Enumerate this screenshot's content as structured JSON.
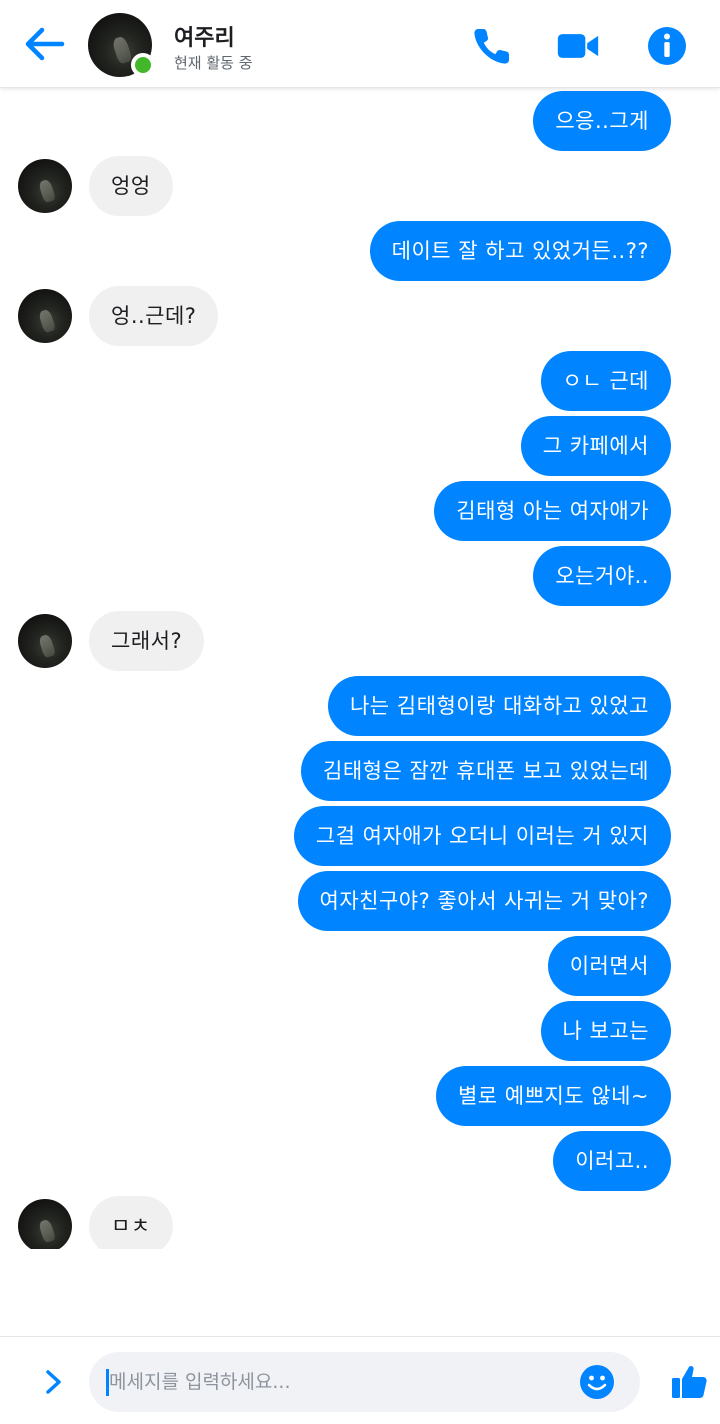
{
  "header": {
    "contact_name": "여주리",
    "status": "현재 활동 중",
    "icons": [
      "back-arrow-icon",
      "phone-icon",
      "video-camera-icon",
      "info-icon"
    ],
    "accent_color": "#0084ff",
    "online_color": "#42b72a"
  },
  "messages": [
    {
      "dir": "out",
      "text": "으응..그게"
    },
    {
      "dir": "in",
      "text": "엉엉"
    },
    {
      "dir": "out",
      "text": "데이트 잘 하고 있었거든..??"
    },
    {
      "dir": "in",
      "text": "엉..근데?"
    },
    {
      "dir": "out",
      "text": "ㅇㄴ 근데"
    },
    {
      "dir": "out",
      "text": "그 카페에서"
    },
    {
      "dir": "out",
      "text": "김태형 아는 여자애가"
    },
    {
      "dir": "out",
      "text": "오는거야.."
    },
    {
      "dir": "in",
      "text": "그래서?"
    },
    {
      "dir": "out",
      "text": "나는 김태형이랑 대화하고 있었고"
    },
    {
      "dir": "out",
      "text": "김태형은 잠깐 휴대폰 보고 있었는데"
    },
    {
      "dir": "out",
      "text": "그걸 여자애가 오더니 이러는 거 있지"
    },
    {
      "dir": "out",
      "text": "여자친구야? 좋아서 사귀는 거 맞아?"
    },
    {
      "dir": "out",
      "text": "이러면서"
    },
    {
      "dir": "out",
      "text": "나 보고는"
    },
    {
      "dir": "out",
      "text": "별로 예쁘지도 않네~"
    },
    {
      "dir": "out",
      "text": "이러고.."
    },
    {
      "dir": "in",
      "text": "ㅁㅊ"
    }
  ],
  "composer": {
    "placeholder": "메세지를 입력하세요...",
    "icons": [
      "chevron-right-icon",
      "emoji-icon",
      "thumbs-up-icon"
    ]
  }
}
